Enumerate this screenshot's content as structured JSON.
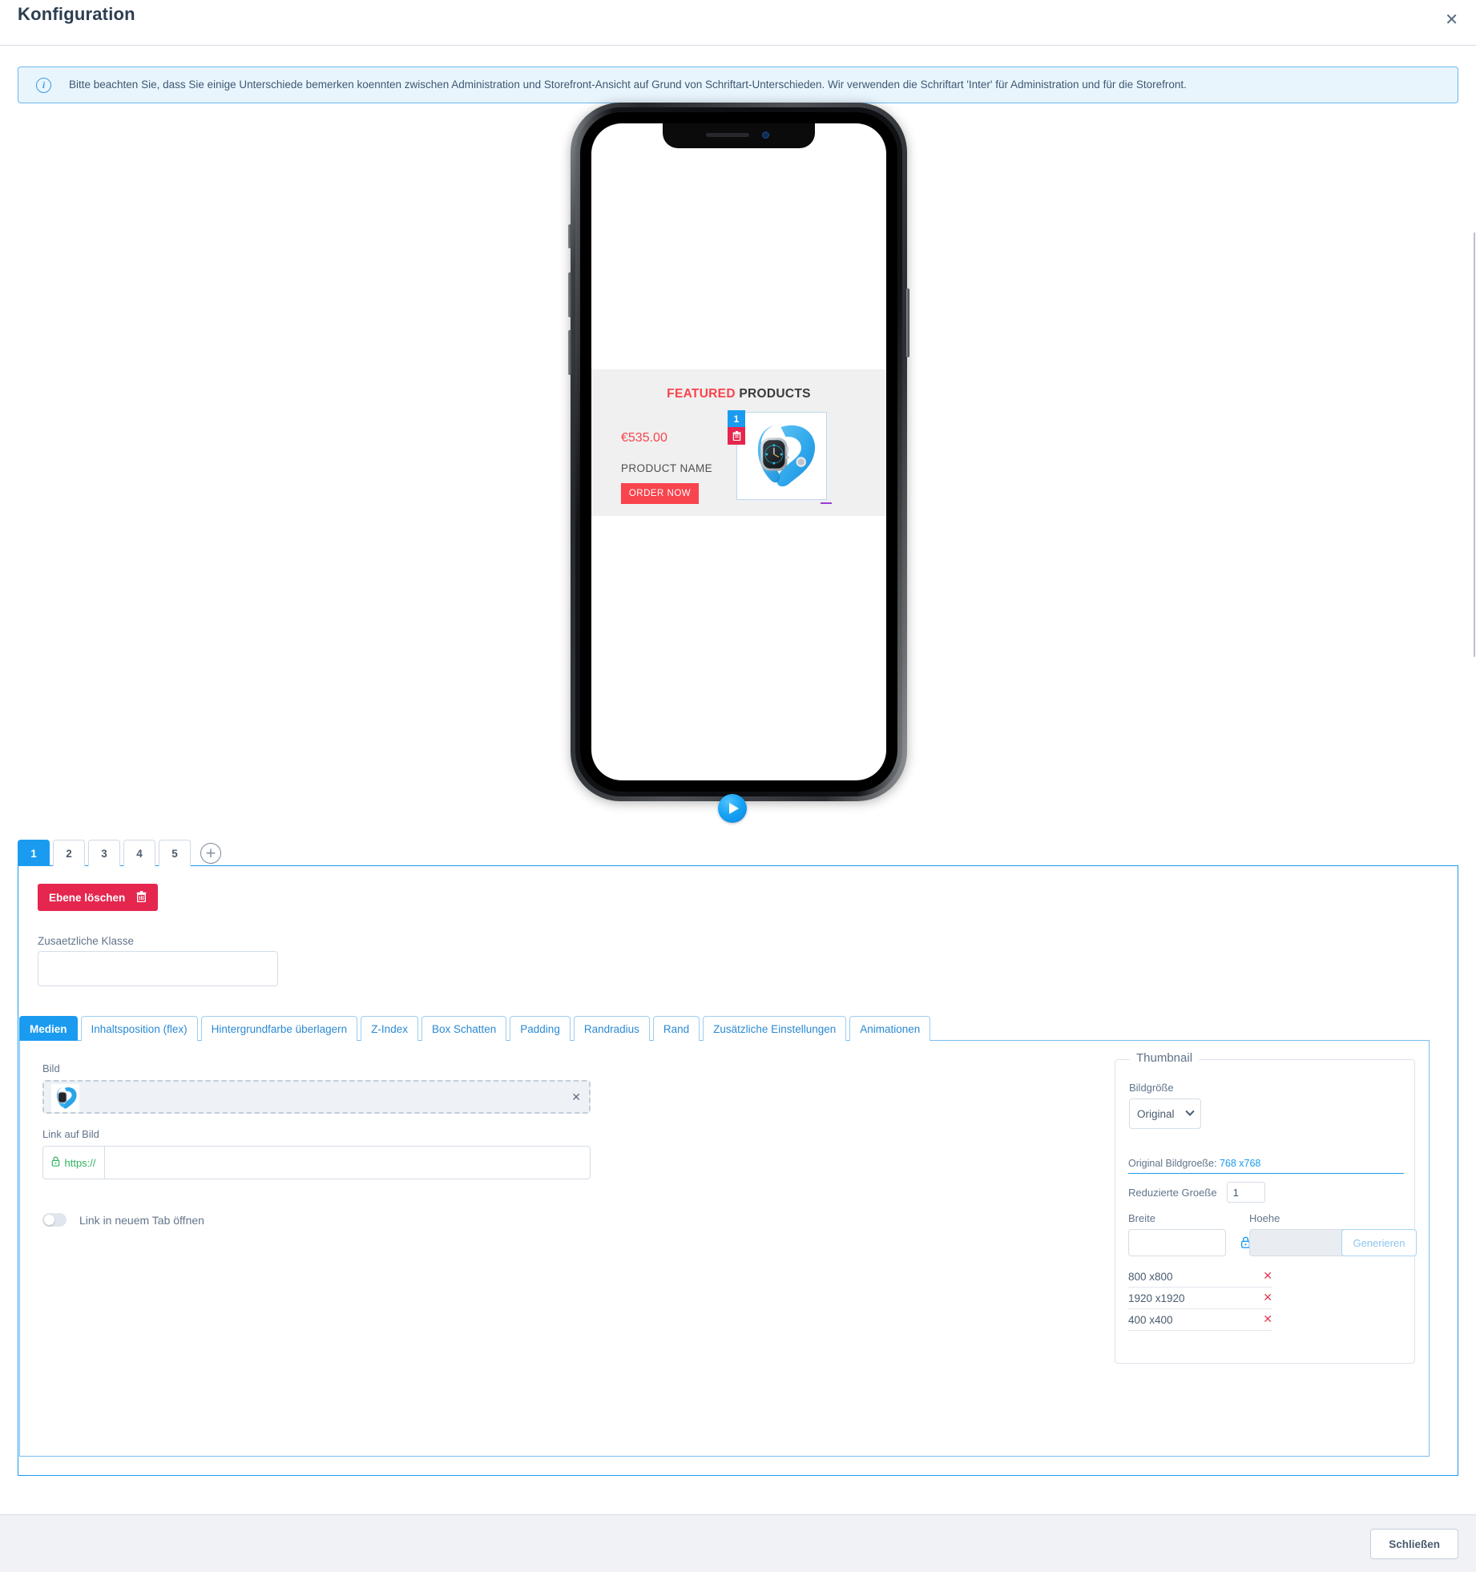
{
  "modal": {
    "title": "Konfiguration",
    "close_icon": "close-icon",
    "footer_close_label": "Schließen"
  },
  "alert": {
    "icon": "info-icon",
    "text": "Bitte beachten Sie, dass Sie einige Unterschiede bemerken koennten zwischen Administration und Storefront-Ansicht auf Grund von Schriftart-Unterschieden. Wir verwenden die Schriftart 'Inter' für Administration und für die Storefront."
  },
  "preview": {
    "device": "iphone-mockup",
    "play_button_icon": "play-icon",
    "product_card": {
      "title_highlight": "FEATURED",
      "title_rest": "PRODUCTS",
      "price": "€535.00",
      "product_name": "PRODUCT NAME",
      "order_label": "ORDER NOW",
      "badge_number": "1",
      "badge_trash_icon": "trash-icon",
      "image_alt": "blue-smartwatch"
    }
  },
  "layer_tabs": {
    "items": [
      {
        "label": "1",
        "active": true
      },
      {
        "label": "2",
        "active": false
      },
      {
        "label": "3",
        "active": false
      },
      {
        "label": "4",
        "active": false
      },
      {
        "label": "5",
        "active": false
      }
    ],
    "add_icon": "plus-icon"
  },
  "layer_panel": {
    "delete_label": "Ebene löschen",
    "delete_icon": "trash-icon",
    "class_label": "Zusaetzliche Klasse",
    "class_value": "",
    "class_placeholder": ""
  },
  "style_tabs": [
    {
      "label": "Medien",
      "active": true
    },
    {
      "label": "Inhaltsposition (flex)",
      "active": false
    },
    {
      "label": "Hintergrundfarbe überlagern",
      "active": false
    },
    {
      "label": "Z-Index",
      "active": false
    },
    {
      "label": "Box Schatten",
      "active": false
    },
    {
      "label": "Padding",
      "active": false
    },
    {
      "label": "Randradius",
      "active": false
    },
    {
      "label": "Rand",
      "active": false
    },
    {
      "label": "Zusätzliche Einstellungen",
      "active": false
    },
    {
      "label": "Animationen",
      "active": false
    }
  ],
  "media": {
    "image_label": "Bild",
    "image_remove_icon": "close-icon",
    "link_label": "Link auf Bild",
    "link_prefix": "https://",
    "link_prefix_icon": "lock-icon",
    "link_value": "",
    "link_placeholder": "",
    "new_tab_label": "Link in neuem Tab öffnen",
    "new_tab_enabled": false
  },
  "thumbnail": {
    "legend": "Thumbnail",
    "size_label": "Bildgröße",
    "size_value": "Original",
    "size_chevron_icon": "chevron-down-icon",
    "original_size_prefix": "Original Bildgroeße:",
    "original_size_value": "768 x768",
    "reduced_label": "Reduzierte Groeße",
    "reduced_value": "1",
    "width_label": "Breite",
    "width_value": "",
    "height_label": "Hoehe",
    "height_value": "",
    "lock_icon": "lock-icon",
    "generate_label": "Generieren",
    "sizes": [
      {
        "label": "800 x800",
        "remove_icon": "x-icon"
      },
      {
        "label": "1920 x1920",
        "remove_icon": "x-icon"
      },
      {
        "label": "400 x400",
        "remove_icon": "x-icon"
      }
    ]
  },
  "colors": {
    "accent_blue": "#1a9bf0",
    "danger_red": "#e5264e",
    "product_red": "#f8444d",
    "link_green": "#32b35f",
    "text": "#4a5b6e"
  }
}
